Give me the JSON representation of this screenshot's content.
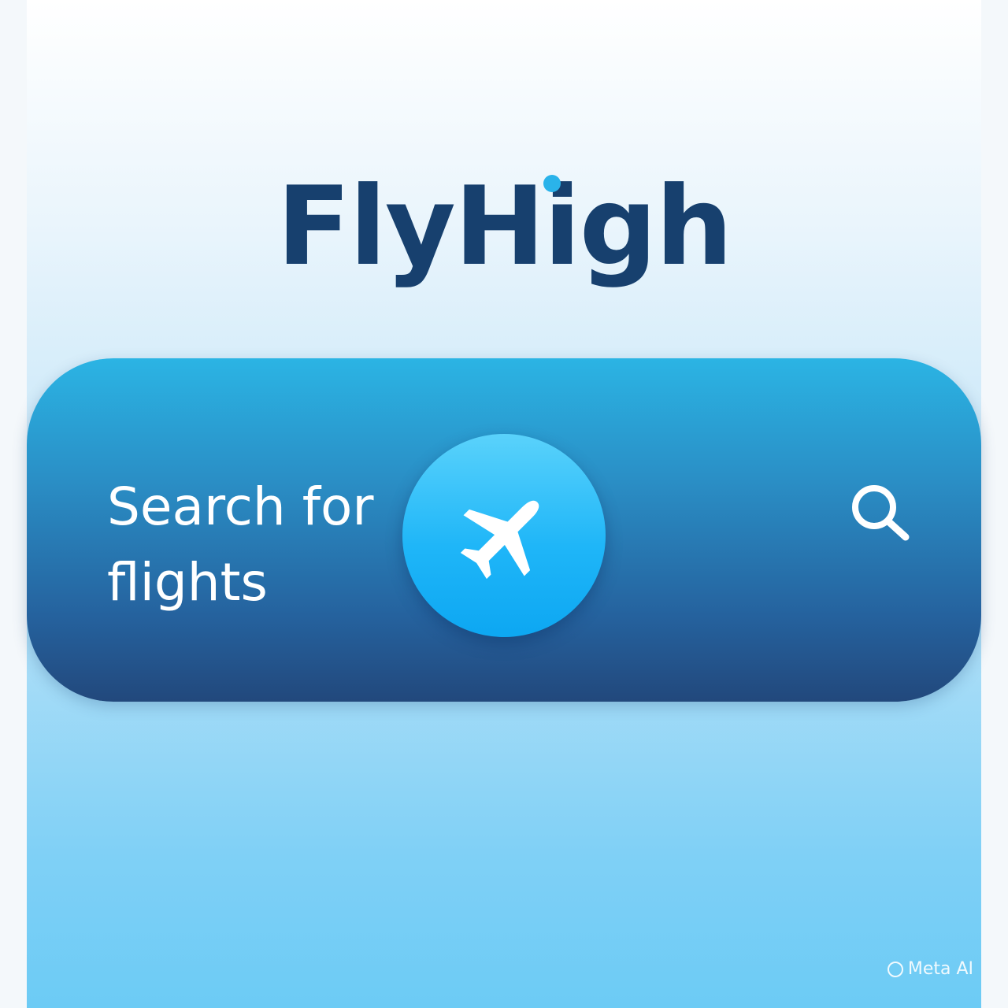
{
  "app": {
    "brand_name": "FlyHigh"
  },
  "search": {
    "label_line1": "Search for",
    "label_line2": "flights",
    "plane_button_icon": "airplane-icon",
    "search_icon": "magnifier-icon"
  },
  "watermark": {
    "text": "Meta AI"
  },
  "colors": {
    "brand_text": "#17406e",
    "accent": "#2ab3ea",
    "bar_top": "#2bb4e4",
    "bar_bottom": "#22487c",
    "button": "#1fb6f8"
  }
}
